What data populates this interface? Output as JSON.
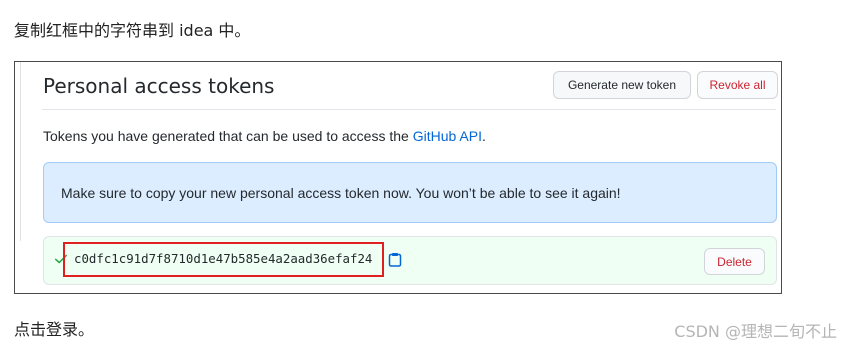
{
  "doc": {
    "intro_text": "复制红框中的字符串到 idea 中。",
    "outro_text": "点击登录。",
    "watermark": "CSDN @理想二旬不止"
  },
  "github": {
    "title": "Personal access tokens",
    "generate_button": "Generate new token",
    "revoke_button": "Revoke all",
    "description_prefix": "Tokens you have generated that can be used to access the ",
    "description_link": "GitHub API",
    "description_suffix": ".",
    "flash_message": "Make sure to copy your new personal access token now. You won’t be able to see it again!",
    "token": "c0dfc1c91d7f8710d1e47b585e4a2aad36efaf24",
    "delete_button": "Delete",
    "icons": {
      "check": "check-icon",
      "copy": "clipboard-copy-icon"
    },
    "colors": {
      "link": "#0366d6",
      "danger": "#cb2431",
      "flash_bg": "#dbedff",
      "token_bg": "#f0fff4",
      "highlight": "#e02020"
    }
  }
}
